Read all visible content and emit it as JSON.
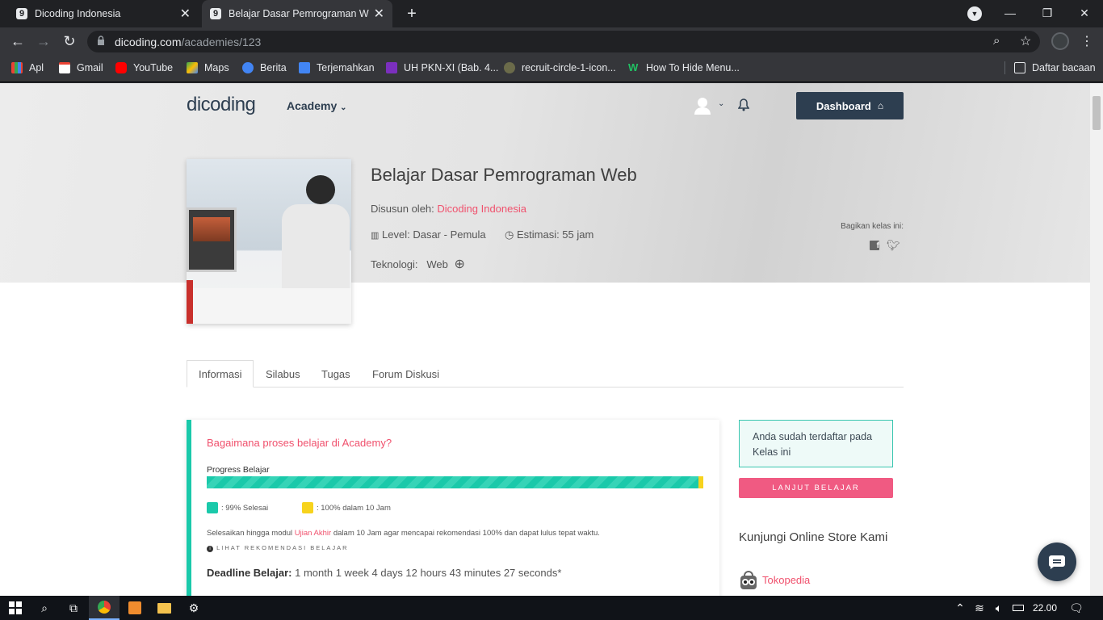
{
  "browser": {
    "tabs": [
      {
        "title": "Dicoding Indonesia"
      },
      {
        "title": "Belajar Dasar Pemrograman Web"
      }
    ],
    "url_domain": "dicoding.com",
    "url_path": "/academies/123",
    "bookmarks": [
      {
        "label": "Apl"
      },
      {
        "label": "Gmail"
      },
      {
        "label": "YouTube"
      },
      {
        "label": "Maps"
      },
      {
        "label": "Berita"
      },
      {
        "label": "Terjemahkan"
      },
      {
        "label": "UH PKN-XI (Bab. 4..."
      },
      {
        "label": "recruit-circle-1-icon..."
      },
      {
        "label": "How To Hide Menu..."
      }
    ],
    "reading_list": "Daftar bacaan"
  },
  "site": {
    "logo": "dicoding",
    "nav_academy": "Academy",
    "dashboard_button": "Dashboard"
  },
  "course": {
    "title": "Belajar Dasar Pemrograman Web",
    "author_label": "Disusun oleh:",
    "author": "Dicoding Indonesia",
    "level": "Level: Dasar - Pemula",
    "estimate": "Estimasi: 55 jam",
    "tech_label": "Teknologi:",
    "tech_value": "Web",
    "share_label": "Bagikan kelas ini:"
  },
  "page_tabs": [
    "Informasi",
    "Silabus",
    "Tugas",
    "Forum Diskusi"
  ],
  "learning": {
    "heading": "Bagaimana proses belajar di Academy?",
    "progress_label": "Progress Belajar",
    "progress_done_fraction": 0.99,
    "legend_done": ": 99% Selesai",
    "legend_target": ": 100% dalam 10 Jam",
    "note_pre": "Selesaikan hingga modul ",
    "note_link": "Ujian Akhir",
    "note_post": " dalam 10 Jam agar mencapai rekomendasi 100% dan dapat lulus tepat waktu.",
    "recommend_link": "LIHAT REKOMENDASI BELAJAR",
    "deadline_label": "Deadline Belajar:",
    "deadline_value": "1 month 1 week 4 days 12 hours 43 minutes 27 seconds*"
  },
  "sidebar": {
    "enrolled": "Anda sudah terdaftar pada Kelas ini",
    "continue_button": "LANJUT BELAJAR",
    "store_heading": "Kunjungi Online Store Kami",
    "store_link": "Tokopedia"
  },
  "taskbar": {
    "clock": "22.00"
  },
  "colors": {
    "accent_pink": "#f05a82",
    "brand_dark": "#2d3e50",
    "progress_teal": "#1ac9aa",
    "progress_yellow": "#f7d31d"
  }
}
